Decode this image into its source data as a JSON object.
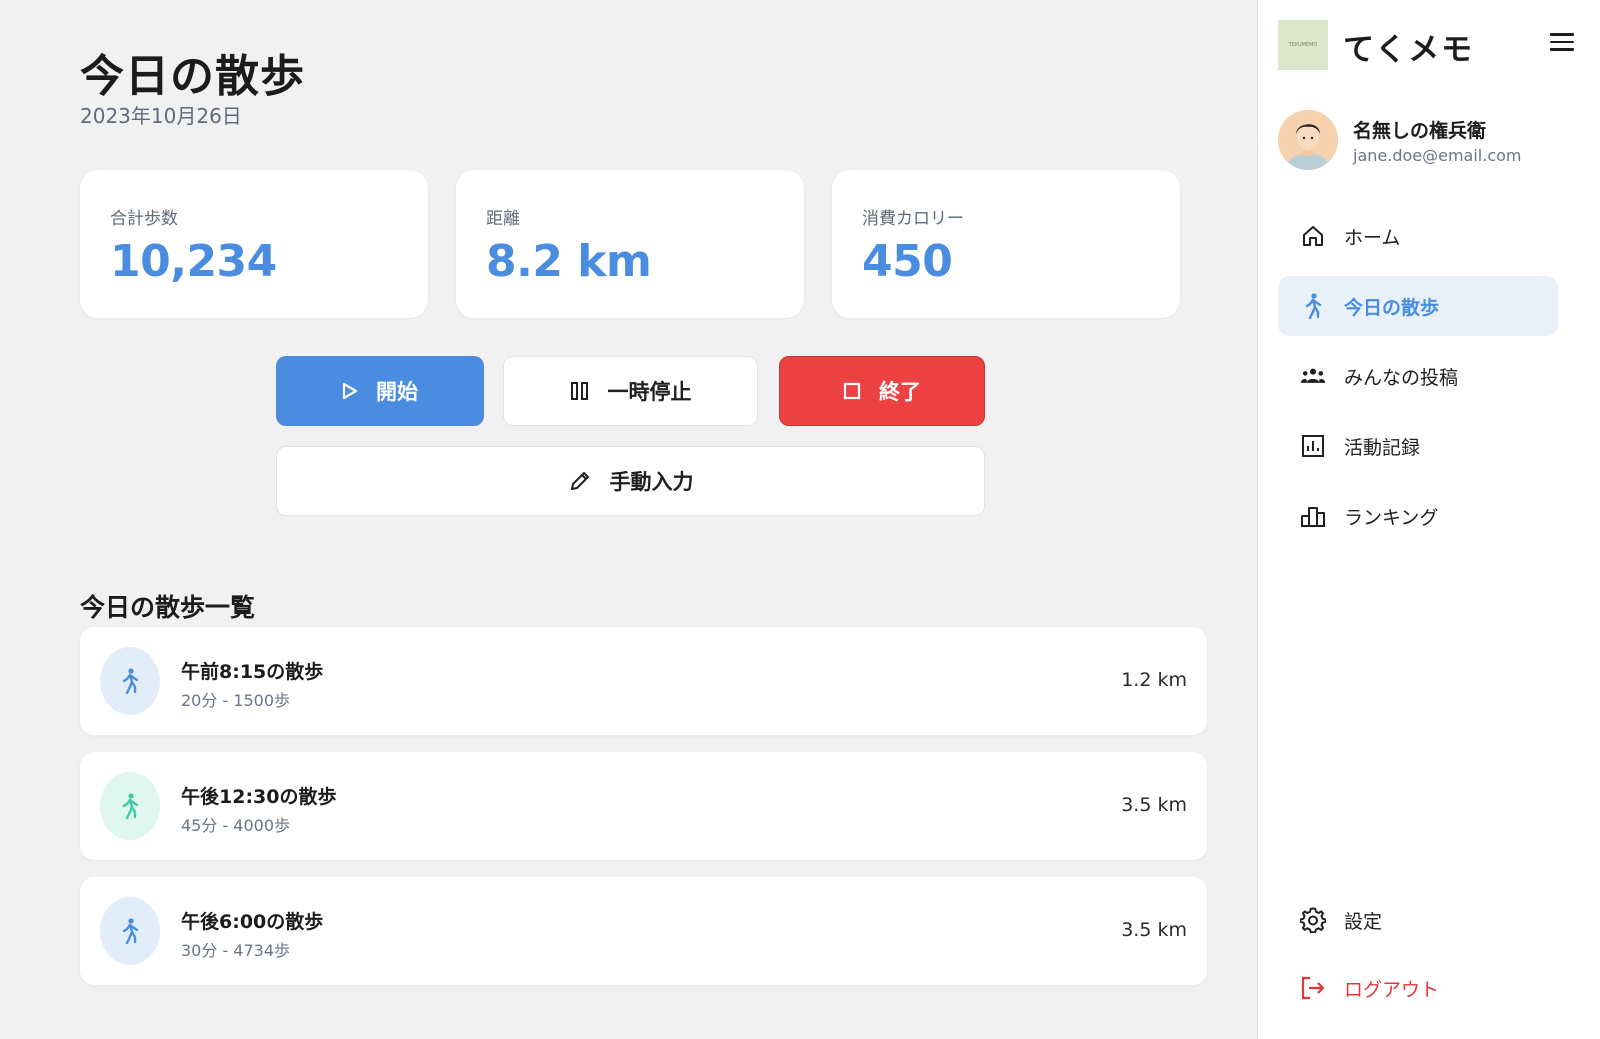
{
  "header": {
    "title": "今日の散歩",
    "date": "2023年10月26日"
  },
  "stats": [
    {
      "label": "合計歩数",
      "value": "10,234"
    },
    {
      "label": "距離",
      "value": "8.2 km"
    },
    {
      "label": "消費カロリー",
      "value": "450"
    }
  ],
  "actions": {
    "start_label": "開始",
    "pause_label": "一時停止",
    "end_label": "終了",
    "manual_label": "手動入力"
  },
  "walks": {
    "section_title": "今日の散歩一覧",
    "items": [
      {
        "title": "午前8:15の散歩",
        "detail": "20分 - 1500歩",
        "distance": "1.2 km",
        "accent": "#4a8de0",
        "bg": "#e2edfa"
      },
      {
        "title": "午後12:30の散歩",
        "detail": "45分 - 4000歩",
        "distance": "3.5 km",
        "accent": "#3ecba4",
        "bg": "#dff7ef"
      },
      {
        "title": "午後6:00の散歩",
        "detail": "30分 - 4734歩",
        "distance": "3.5 km",
        "accent": "#4a8de0",
        "bg": "#e2edfa"
      }
    ]
  },
  "sidebar": {
    "app_title": "てくメモ",
    "logo_text": "TEKUMEMO",
    "user": {
      "name": "名無しの権兵衛",
      "email": "jane.doe@email.com"
    },
    "nav": [
      {
        "label": "ホーム",
        "icon": "home-icon"
      },
      {
        "label": "今日の散歩",
        "icon": "walk-icon"
      },
      {
        "label": "みんなの投稿",
        "icon": "group-icon"
      },
      {
        "label": "活動記録",
        "icon": "chart-icon"
      },
      {
        "label": "ランキング",
        "icon": "ranking-icon"
      }
    ],
    "settings_label": "設定",
    "logout_label": "ログアウト"
  },
  "colors": {
    "primary": "#4a8de0",
    "danger": "#ec4242",
    "walk_green": "#3ecba4"
  }
}
